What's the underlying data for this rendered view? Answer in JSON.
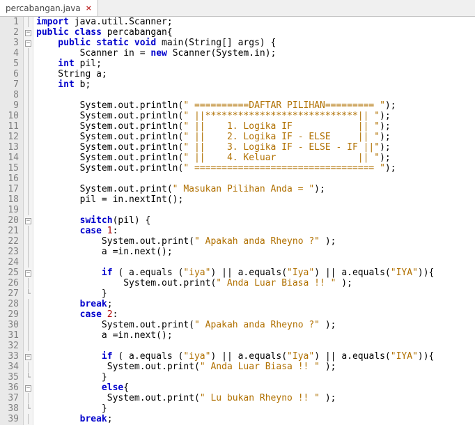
{
  "tab": {
    "title": "percabangan.java",
    "close_glyph": "×"
  },
  "line_numbers": [
    "1",
    "2",
    "3",
    "4",
    "5",
    "6",
    "7",
    "8",
    "9",
    "10",
    "11",
    "12",
    "13",
    "14",
    "15",
    "16",
    "17",
    "18",
    "19",
    "20",
    "21",
    "22",
    "23",
    "24",
    "25",
    "26",
    "27",
    "28",
    "29",
    "30",
    "31",
    "32",
    "33",
    "34",
    "35",
    "36",
    "37",
    "38",
    "39"
  ],
  "fold_markers": [
    "",
    "box",
    "box",
    "",
    "",
    "",
    "",
    "",
    "",
    "",
    "",
    "",
    "",
    "",
    "",
    "",
    "",
    "",
    "",
    "box",
    "",
    "",
    "",
    "",
    "box",
    "",
    "end",
    "",
    "",
    "",
    "",
    "",
    "box",
    "",
    "end",
    "box",
    "",
    "end",
    ""
  ],
  "code": {
    "l1": {
      "a": "import ",
      "b": "java.util.Scanner;"
    },
    "l2": {
      "a": "public class ",
      "b": "percabangan",
      "c": "{"
    },
    "l3": {
      "a": "    public static void ",
      "b": "main(String[] args) {"
    },
    "l4": {
      "a": "        Scanner in = ",
      "b": "new ",
      "c": "Scanner(System.in);"
    },
    "l5": {
      "a": "    int ",
      "b": "pil;"
    },
    "l6": {
      "a": "    String a;"
    },
    "l7": {
      "a": "    int ",
      "b": "b;"
    },
    "l8": {
      "a": ""
    },
    "l9": {
      "a": "        System.out.println(",
      "b": "\" ==========DAFTAR PILIHAN========= \"",
      "c": ");"
    },
    "l10": {
      "a": "        System.out.println(",
      "b": "\" ||****************************|| \"",
      "c": ");"
    },
    "l11": {
      "a": "        System.out.println(",
      "b": "\" ||    1. Logika IF            || \"",
      "c": ");"
    },
    "l12": {
      "a": "        System.out.println(",
      "b": "\" ||    2. Logika IF - ELSE     || \"",
      "c": ");"
    },
    "l13": {
      "a": "        System.out.println(",
      "b": "\" ||    3. Logika IF - ELSE - IF ||\"",
      "c": ");"
    },
    "l14": {
      "a": "        System.out.println(",
      "b": "\" ||    4. Keluar               || \"",
      "c": ");"
    },
    "l15": {
      "a": "        System.out.println(",
      "b": "\" ================================= \"",
      "c": ");"
    },
    "l16": {
      "a": ""
    },
    "l17": {
      "a": "        System.out.print(",
      "b": "\" Masukan Pilihan Anda = \"",
      "c": ");"
    },
    "l18": {
      "a": "        pil = in.nextInt();"
    },
    "l19": {
      "a": ""
    },
    "l20": {
      "a": "        switch",
      "b": "(pil) {"
    },
    "l21": {
      "a": "        case ",
      "b": "1",
      "c": ":"
    },
    "l22": {
      "a": "            System.out.print(",
      "b": "\" Apakah anda Rheyno ?\"",
      "c": " );"
    },
    "l23": {
      "a": "            a =in.next();"
    },
    "l24": {
      "a": ""
    },
    "l25": {
      "a": "            if ",
      "b": "( a.equals (",
      "c": "\"iya\"",
      "d": ") || a.equals(",
      "e": "\"Iya\"",
      "f": ") || a.equals(",
      "g": "\"IYA\"",
      "h": ")){"
    },
    "l26": {
      "a": "                System.out.print(",
      "b": "\" Anda Luar Biasa !! \"",
      "c": " );"
    },
    "l27": {
      "a": "            }"
    },
    "l28": {
      "a": "        break",
      "b": ";"
    },
    "l29": {
      "a": "        case ",
      "b": "2",
      "c": ":"
    },
    "l30": {
      "a": "            System.out.print(",
      "b": "\" Apakah anda Rheyno ?\"",
      "c": " );"
    },
    "l31": {
      "a": "            a =in.next();"
    },
    "l32": {
      "a": ""
    },
    "l33": {
      "a": "            if ",
      "b": "( a.equals (",
      "c": "\"iya\"",
      "d": ") || a.equals(",
      "e": "\"Iya\"",
      "f": ") || a.equals(",
      "g": "\"IYA\"",
      "h": ")){"
    },
    "l34": {
      "a": "             System.out.print(",
      "b": "\" Anda Luar Biasa !! \"",
      "c": " );"
    },
    "l35": {
      "a": "            }"
    },
    "l36": {
      "a": "            else",
      "b": "{"
    },
    "l37": {
      "a": "             System.out.print(",
      "b": "\" Lu bukan Rheyno !! \"",
      "c": " );"
    },
    "l38": {
      "a": "            }"
    },
    "l39": {
      "a": "        break",
      "b": ";"
    }
  }
}
